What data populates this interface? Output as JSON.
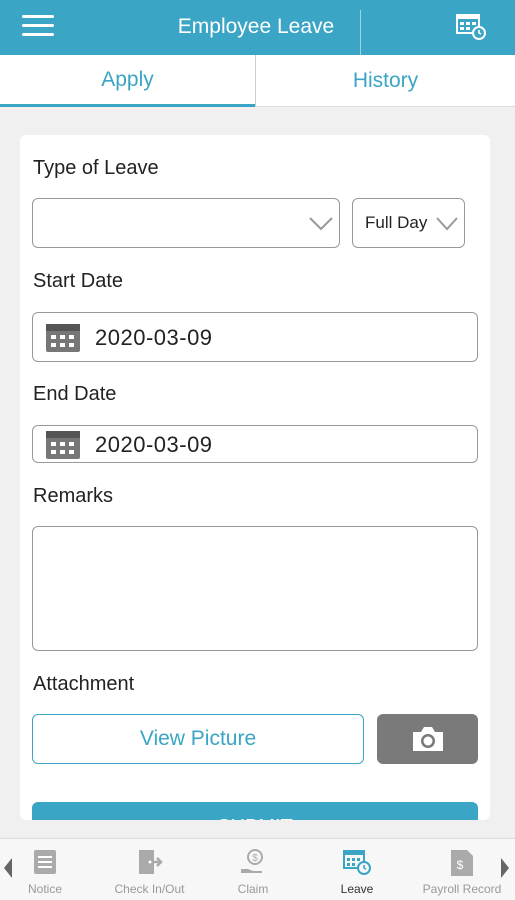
{
  "header": {
    "title": "Employee Leave",
    "menu_icon": "hamburger-icon",
    "right_icon": "calendar-clock-icon",
    "color": "#3aa5c4"
  },
  "tabs": [
    {
      "label": "Apply",
      "active": true
    },
    {
      "label": "History",
      "active": false
    }
  ],
  "form": {
    "type_of_leave_label": "Type of Leave",
    "type_of_leave_value": "",
    "duration_value": "Full Day",
    "start_date_label": "Start Date",
    "start_date_value": "2020-03-09",
    "end_date_label": "End Date",
    "end_date_value": "2020-03-09",
    "remarks_label": "Remarks",
    "remarks_value": "",
    "attachment_label": "Attachment",
    "view_picture_label": "View Picture",
    "camera_icon": "camera-icon",
    "submit_label": "SUBMIT"
  },
  "bottom_nav": {
    "items": [
      {
        "label": "Notice",
        "icon": "notice-icon",
        "active": false
      },
      {
        "label": "Check In/Out",
        "icon": "check-in-out-icon",
        "active": false
      },
      {
        "label": "Claim",
        "icon": "claim-icon",
        "active": false
      },
      {
        "label": "Leave",
        "icon": "leave-icon",
        "active": true
      },
      {
        "label": "Payroll Record",
        "icon": "payroll-record-icon",
        "active": false
      }
    ]
  }
}
